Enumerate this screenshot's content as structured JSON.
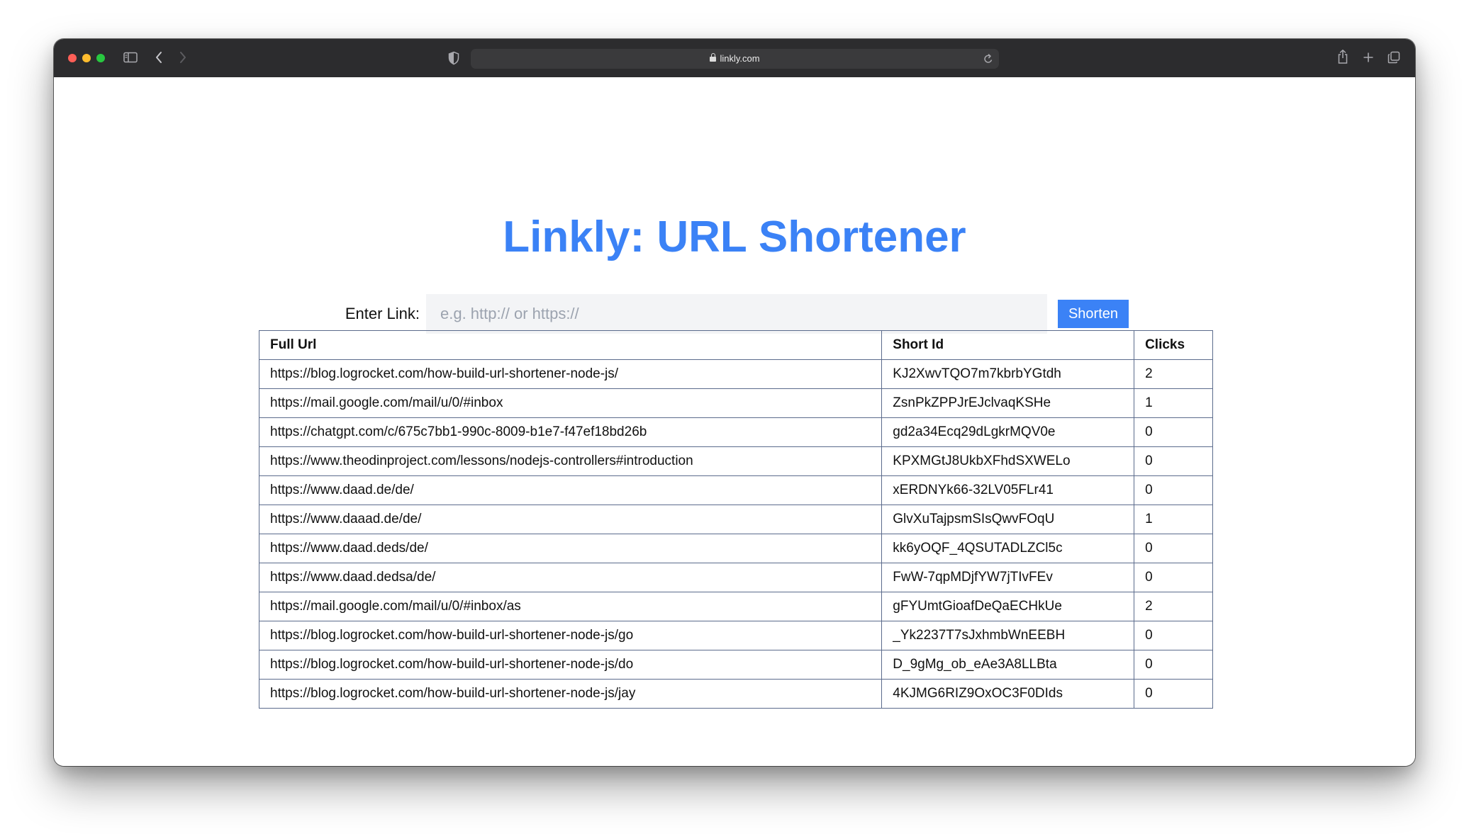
{
  "browser": {
    "url": "linkly.com"
  },
  "page": {
    "title": "Linkly: URL Shortener",
    "form": {
      "label": "Enter Link:",
      "placeholder": "e.g. http:// or https://",
      "value": "",
      "button_label": "Shorten"
    },
    "table": {
      "headers": {
        "full_url": "Full Url",
        "short_id": "Short Id",
        "clicks": "Clicks"
      },
      "rows": [
        {
          "full_url": "https://blog.logrocket.com/how-build-url-shortener-node-js/",
          "short_id": "KJ2XwvTQO7m7kbrbYGtdh",
          "clicks": "2"
        },
        {
          "full_url": "https://mail.google.com/mail/u/0/#inbox",
          "short_id": "ZsnPkZPPJrEJclvaqKSHe",
          "clicks": "1"
        },
        {
          "full_url": "https://chatgpt.com/c/675c7bb1-990c-8009-b1e7-f47ef18bd26b",
          "short_id": "gd2a34Ecq29dLgkrMQV0e",
          "clicks": "0"
        },
        {
          "full_url": "https://www.theodinproject.com/lessons/nodejs-controllers#introduction",
          "short_id": "KPXMGtJ8UkbXFhdSXWELo",
          "clicks": "0"
        },
        {
          "full_url": "https://www.daad.de/de/",
          "short_id": "xERDNYk66-32LV05FLr41",
          "clicks": "0"
        },
        {
          "full_url": "https://www.daaad.de/de/",
          "short_id": "GlvXuTajpsmSIsQwvFOqU",
          "clicks": "1"
        },
        {
          "full_url": "https://www.daad.deds/de/",
          "short_id": "kk6yOQF_4QSUTADLZCl5c",
          "clicks": "0"
        },
        {
          "full_url": "https://www.daad.dedsa/de/",
          "short_id": "FwW-7qpMDjfYW7jTIvFEv",
          "clicks": "0"
        },
        {
          "full_url": "https://mail.google.com/mail/u/0/#inbox/as",
          "short_id": "gFYUmtGioafDeQaECHkUe",
          "clicks": "2"
        },
        {
          "full_url": "https://blog.logrocket.com/how-build-url-shortener-node-js/go",
          "short_id": "_Yk2237T7sJxhmbWnEEBH",
          "clicks": "0"
        },
        {
          "full_url": "https://blog.logrocket.com/how-build-url-shortener-node-js/do",
          "short_id": "D_9gMg_ob_eAe3A8LLBta",
          "clicks": "0"
        },
        {
          "full_url": "https://blog.logrocket.com/how-build-url-shortener-node-js/jay",
          "short_id": "4KJMG6RIZ9OxOC3F0DIds",
          "clicks": "0"
        }
      ]
    }
  },
  "colors": {
    "accent": "#3b82f6",
    "input_bg": "#f3f4f6",
    "table_border": "#5b6b8c",
    "titlebar": "#2c2c2e"
  }
}
